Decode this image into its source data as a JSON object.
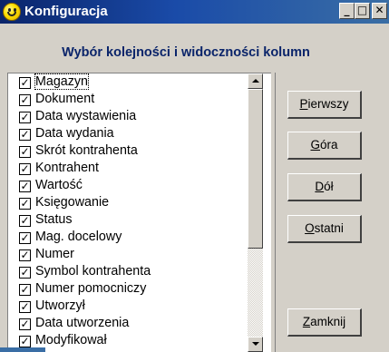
{
  "window": {
    "title": "Konfiguracja",
    "heading": "Wybór kolejności i widoczności kolumn",
    "controls": {
      "minimize": "_",
      "maximize": "□",
      "close": "✕"
    }
  },
  "columns": [
    {
      "label": "Magazyn",
      "checked": true
    },
    {
      "label": "Dokument",
      "checked": true
    },
    {
      "label": "Data wystawienia",
      "checked": true
    },
    {
      "label": "Data wydania",
      "checked": true
    },
    {
      "label": "Skrót kontrahenta",
      "checked": true
    },
    {
      "label": "Kontrahent",
      "checked": true
    },
    {
      "label": "Wartość",
      "checked": true
    },
    {
      "label": "Księgowanie",
      "checked": true
    },
    {
      "label": "Status",
      "checked": true
    },
    {
      "label": "Mag. docelowy",
      "checked": true
    },
    {
      "label": "Numer",
      "checked": true
    },
    {
      "label": "Symbol kontrahenta",
      "checked": true
    },
    {
      "label": "Numer pomocniczy",
      "checked": true
    },
    {
      "label": "Utworzył",
      "checked": true
    },
    {
      "label": "Data utworzenia",
      "checked": true
    },
    {
      "label": "Modyfikował",
      "checked": true
    }
  ],
  "checkmark": "✓",
  "buttons": {
    "first": {
      "accel": "P",
      "rest": "ierwszy"
    },
    "up": {
      "accel": "G",
      "rest": "óra"
    },
    "down": {
      "accel": "D",
      "rest": "ół"
    },
    "last": {
      "accel": "O",
      "rest": "statni"
    },
    "close": {
      "accel": "Z",
      "rest": "amknij"
    }
  }
}
